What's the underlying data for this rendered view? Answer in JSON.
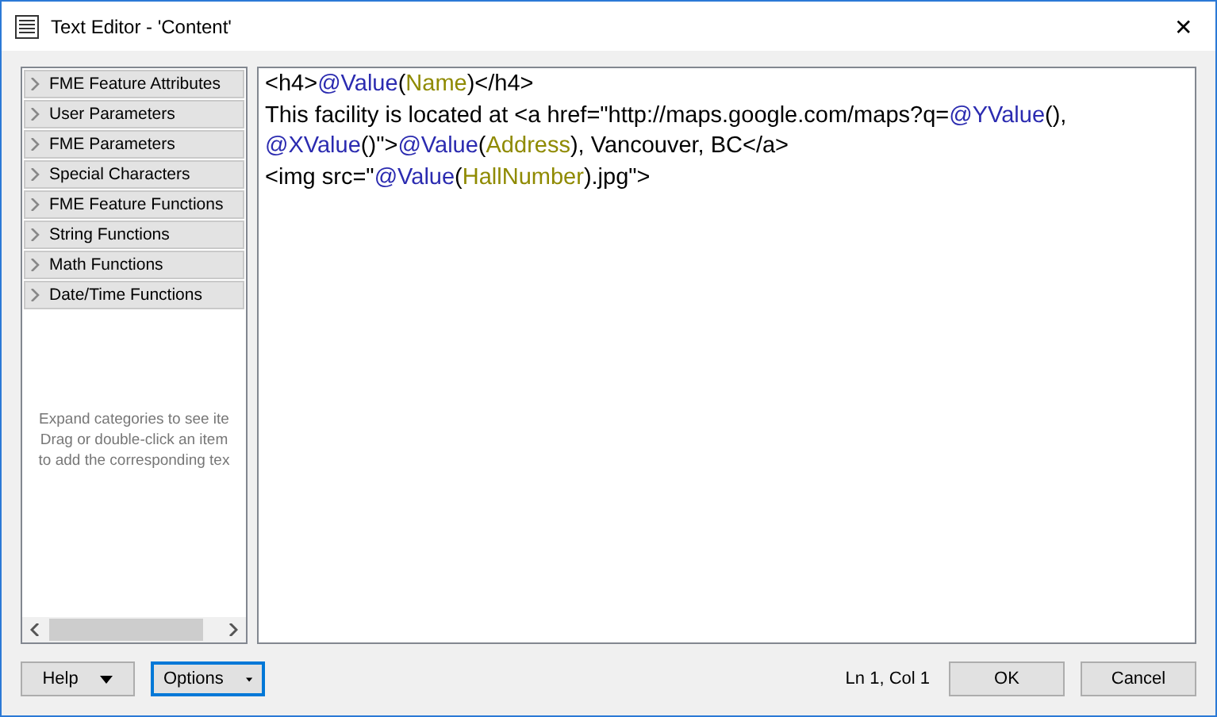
{
  "window": {
    "title": "Text Editor - 'Content'",
    "close": "✕"
  },
  "sidebar": {
    "items": [
      {
        "label": "FME Feature Attributes",
        "expanded": false
      },
      {
        "label": "User Parameters",
        "expanded": false
      },
      {
        "label": "FME Parameters",
        "expanded": false
      },
      {
        "label": "Special Characters",
        "expanded": false
      },
      {
        "label": "FME Feature Functions",
        "expanded": false
      },
      {
        "label": "String Functions",
        "expanded": false
      },
      {
        "label": "Math Functions",
        "expanded": false
      },
      {
        "label": "Date/Time Functions",
        "expanded": false
      }
    ],
    "hint": [
      "Expand categories to see ite",
      "Drag or double-click an item",
      "to add the corresponding tex"
    ]
  },
  "editor": {
    "lines": [
      [
        {
          "kind": "plain",
          "text": "<h4>"
        },
        {
          "kind": "function",
          "text": "@Value"
        },
        {
          "kind": "plain",
          "text": "("
        },
        {
          "kind": "attribute",
          "text": "Name"
        },
        {
          "kind": "plain",
          "text": ")</h4>"
        }
      ],
      [
        {
          "kind": "plain",
          "text": "This facility is located at <a href=\"http://maps.google.com/maps?q="
        },
        {
          "kind": "function",
          "text": "@YValue"
        },
        {
          "kind": "plain",
          "text": "(),"
        }
      ],
      [
        {
          "kind": "function",
          "text": "@XValue"
        },
        {
          "kind": "plain",
          "text": "()\">"
        },
        {
          "kind": "function",
          "text": "@Value"
        },
        {
          "kind": "plain",
          "text": "("
        },
        {
          "kind": "attribute",
          "text": "Address"
        },
        {
          "kind": "plain",
          "text": "), Vancouver, BC</a>"
        }
      ],
      [
        {
          "kind": "plain",
          "text": "<img src=\""
        },
        {
          "kind": "function",
          "text": "@Value"
        },
        {
          "kind": "plain",
          "text": "("
        },
        {
          "kind": "attribute",
          "text": "HallNumber"
        },
        {
          "kind": "plain",
          "text": ").jpg\">"
        }
      ]
    ]
  },
  "footer": {
    "help": "Help",
    "options": "Options",
    "position": "Ln 1, Col 1",
    "ok": "OK",
    "cancel": "Cancel"
  }
}
